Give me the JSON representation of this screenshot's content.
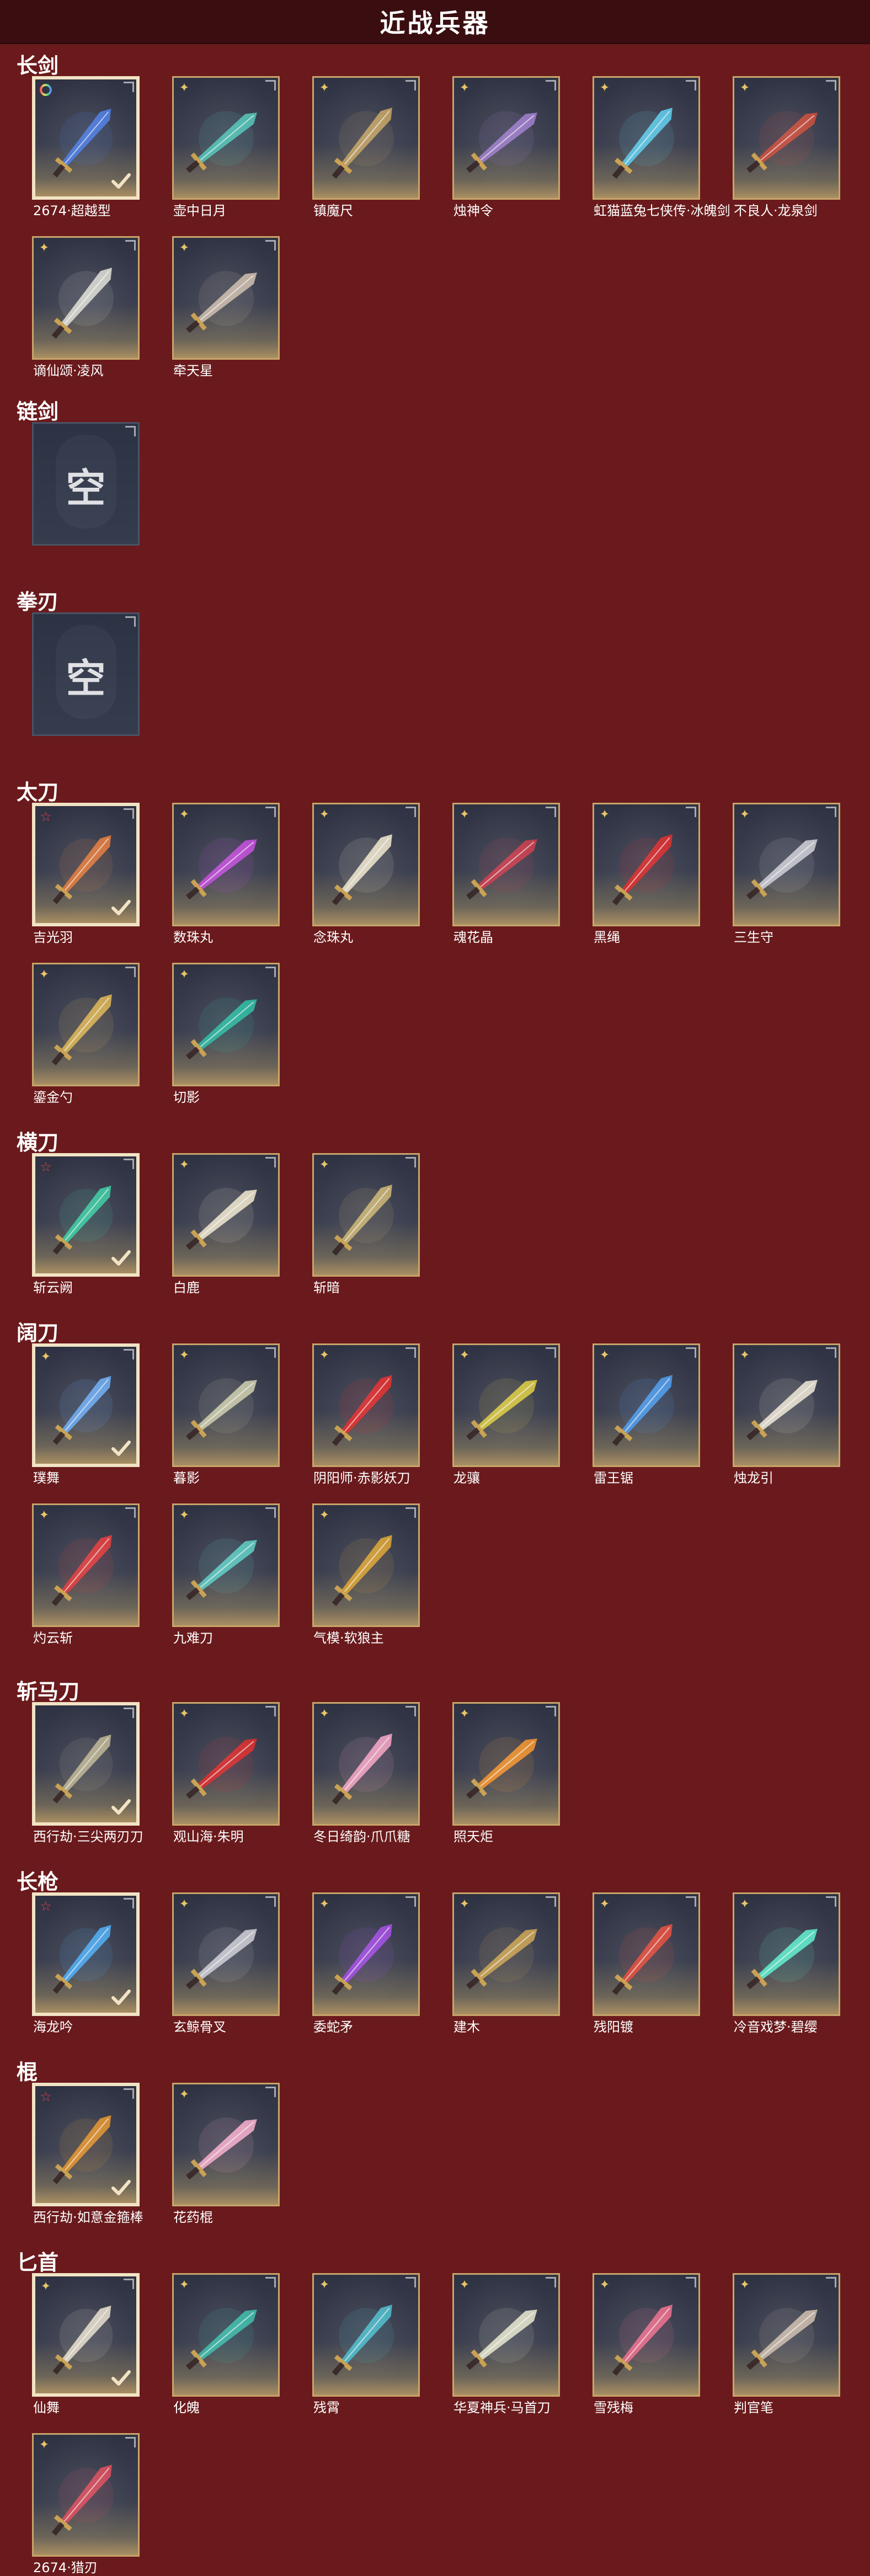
{
  "page_title": "近战兵器",
  "sections": [
    {
      "name": "长剑",
      "items": [
        {
          "label": "2674·超越型",
          "badge": "rainbow",
          "selected": true,
          "color": "#4a7ae0"
        },
        {
          "label": "壶中日月",
          "badge": "gold",
          "color": "#4fc0b4"
        },
        {
          "label": "镇魔尺",
          "badge": "gold",
          "color": "#c0a060"
        },
        {
          "label": "烛神令",
          "badge": "gold",
          "color": "#9a7ac8"
        },
        {
          "label": "虹猫蓝兔七侠传·冰魄剑",
          "badge": "gold",
          "color": "#5ac8e8"
        },
        {
          "label": "不良人·龙泉剑",
          "badge": "gold",
          "color": "#c84a3a"
        },
        {
          "label": "谪仙颂·凌风",
          "badge": "gold",
          "color": "#d8d8d0"
        },
        {
          "label": "牵天星",
          "badge": "gold",
          "color": "#c8b8a8"
        }
      ]
    },
    {
      "name": "链剑",
      "items": [
        {
          "label": "",
          "empty": true,
          "empty_text": "空"
        }
      ]
    },
    {
      "name": "拳刃",
      "items": [
        {
          "label": "",
          "empty": true,
          "empty_text": "空"
        }
      ]
    },
    {
      "name": "太刀",
      "items": [
        {
          "label": "吉光羽",
          "badge": "star",
          "selected": true,
          "color": "#e0783a"
        },
        {
          "label": "数珠丸",
          "badge": "gold",
          "color": "#c04ad8"
        },
        {
          "label": "念珠丸",
          "badge": "gold",
          "color": "#e8e0c8"
        },
        {
          "label": "魂花晶",
          "badge": "gold",
          "color": "#c83a4a"
        },
        {
          "label": "黑绳",
          "badge": "gold",
          "color": "#d82a2a"
        },
        {
          "label": "三生守",
          "badge": "gold",
          "color": "#c8c8d0"
        },
        {
          "label": "鎏金勺",
          "badge": "gold",
          "color": "#d8b050"
        },
        {
          "label": "切影",
          "badge": "gold",
          "color": "#2ab8a0"
        }
      ]
    },
    {
      "name": "横刀",
      "items": [
        {
          "label": "斩云阙",
          "badge": "star",
          "selected": true,
          "color": "#3ac8a0"
        },
        {
          "label": "白鹿",
          "badge": "gold",
          "color": "#e8e0c8"
        },
        {
          "label": "斩暗",
          "badge": "gold",
          "color": "#c8b070"
        }
      ]
    },
    {
      "name": "阔刀",
      "items": [
        {
          "label": "璞舞",
          "badge": "gold",
          "selected": true,
          "color": "#6aa8f0"
        },
        {
          "label": "暮影",
          "badge": "gold",
          "color": "#c8c8a8"
        },
        {
          "label": "阴阳师·赤影妖刀",
          "badge": "gold",
          "color": "#e02a2a"
        },
        {
          "label": "龙骧",
          "badge": "gold",
          "color": "#d8c840"
        },
        {
          "label": "雷王锯",
          "badge": "gold",
          "color": "#4a98e8"
        },
        {
          "label": "烛龙引",
          "badge": "gold",
          "color": "#e8e0d0"
        },
        {
          "label": "灼云斩",
          "badge": "gold",
          "color": "#e03a3a"
        },
        {
          "label": "九难刀",
          "badge": "gold",
          "color": "#5ac8c0"
        },
        {
          "label": "气模·软狼主",
          "badge": "gold",
          "color": "#d8a030"
        }
      ]
    },
    {
      "name": "斩马刀",
      "items": [
        {
          "label": "西行劫·三尖两刃刀",
          "badge": "none",
          "selected": true,
          "color": "#b8b090"
        },
        {
          "label": "观山海·朱明",
          "badge": "gold",
          "color": "#d82a2a"
        },
        {
          "label": "冬日绮韵·爪爪糖",
          "badge": "gold",
          "color": "#f0a0c0"
        },
        {
          "label": "照天炬",
          "badge": "gold",
          "color": "#f0902a"
        }
      ]
    },
    {
      "name": "长枪",
      "items": [
        {
          "label": "海龙吟",
          "badge": "star",
          "selected": true,
          "color": "#4aa8f0"
        },
        {
          "label": "玄鲸骨叉",
          "badge": "gold",
          "color": "#c8c8d0"
        },
        {
          "label": "委蛇矛",
          "badge": "gold",
          "color": "#a04ae0"
        },
        {
          "label": "建木",
          "badge": "gold",
          "color": "#c8a050"
        },
        {
          "label": "残阳镀",
          "badge": "gold",
          "color": "#e04a3a"
        },
        {
          "label": "冷音戏梦·碧缨",
          "badge": "gold",
          "color": "#5ae8c8"
        }
      ]
    },
    {
      "name": "棍",
      "items": [
        {
          "label": "西行劫·如意金箍棒",
          "badge": "star",
          "selected": true,
          "color": "#e0902a"
        },
        {
          "label": "花药棍",
          "badge": "gold",
          "color": "#f0a8c8"
        }
      ]
    },
    {
      "name": "匕首",
      "items": [
        {
          "label": "仙舞",
          "badge": "gold",
          "selected": true,
          "color": "#e0d8c8"
        },
        {
          "label": "化魄",
          "badge": "gold",
          "color": "#3ab8a8"
        },
        {
          "label": "残霄",
          "badge": "gold",
          "color": "#4ab8c8"
        },
        {
          "label": "华夏神兵·马首刀",
          "badge": "gold",
          "color": "#e0e0c8"
        },
        {
          "label": "雪残梅",
          "badge": "gold",
          "color": "#e86a8a"
        },
        {
          "label": "判官笔",
          "badge": "gold",
          "color": "#c8b8a8"
        },
        {
          "label": "2674·猎刃",
          "badge": "gold",
          "color": "#d84a5a"
        }
      ]
    }
  ],
  "colors": {
    "background": "#6a1a1c",
    "tile_border": "#c8a46a",
    "selected_border": "#f2e3c4",
    "badge_gold": "#e8c46a",
    "badge_star": "#e0424a"
  }
}
